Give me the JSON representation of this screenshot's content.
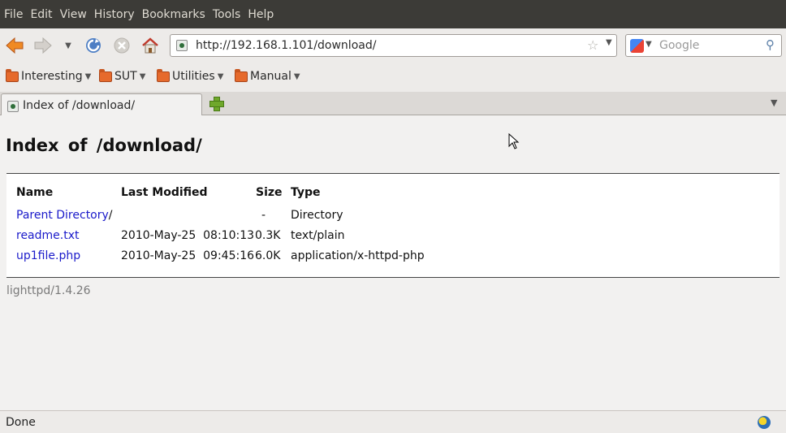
{
  "menu": [
    "File",
    "Edit",
    "View",
    "History",
    "Bookmarks",
    "Tools",
    "Help"
  ],
  "nav": {
    "url": "http://192.168.1.101/download/",
    "search_placeholder": "Google"
  },
  "bookmarks": [
    "Interesting",
    "SUT",
    "Utilities",
    "Manual"
  ],
  "tab": {
    "title": "Index of /download/"
  },
  "page": {
    "heading": "Index of /download/",
    "columns": {
      "name": "Name",
      "modified": "Last Modified",
      "size": "Size",
      "type": "Type"
    },
    "rows": [
      {
        "name": "Parent Directory",
        "suffix": "/",
        "modified": "",
        "size": "-",
        "type": "Directory"
      },
      {
        "name": "readme.txt",
        "suffix": "",
        "modified": "2010-May-25  08:10:13",
        "size": "0.3K",
        "type": "text/plain"
      },
      {
        "name": "up1file.php",
        "suffix": "",
        "modified": "2010-May-25  09:45:16",
        "size": "6.0K",
        "type": "application/x-httpd-php"
      }
    ],
    "server": "lighttpd/1.4.26"
  },
  "status": {
    "text": "Done"
  }
}
